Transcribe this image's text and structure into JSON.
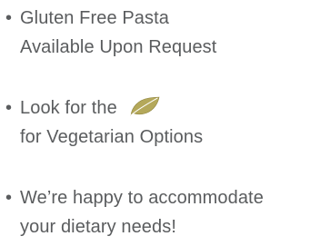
{
  "bullet_char": "•",
  "colors": {
    "text": "#5a5c5e",
    "leaf_fill": "#b4a85a",
    "leaf_stroke": "#8f8540"
  },
  "icons": {
    "vegetarian": "leaf-icon"
  },
  "notes": [
    {
      "line1": "Gluten Free Pasta",
      "line2": "Available Upon Request"
    },
    {
      "line1": "Look for the",
      "line2": "for Vegetarian Options"
    },
    {
      "line1": "We’re happy to accommodate",
      "line2": "your dietary needs!"
    }
  ]
}
